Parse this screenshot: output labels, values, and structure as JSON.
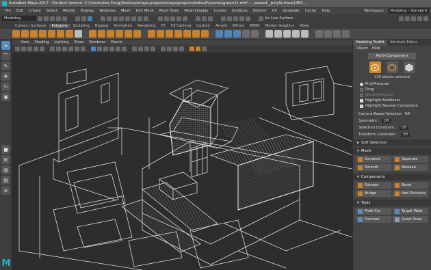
{
  "titlebar": {
    "title": "Autodesk Maya 2017 - Student Version: C:\\Users\\Alex Fung\\Desktop\\maya-projects\\maya\\projects\\default\\scenes\\green21.mb*  ---  pasted__polySurface1383..."
  },
  "menubar": {
    "items": [
      "File",
      "Edit",
      "Create",
      "Select",
      "Modify",
      "Display",
      "Windows",
      "Mesh",
      "Edit Mesh",
      "Mesh Tools",
      "Mesh Display",
      "Curves",
      "Surfaces",
      "Deform",
      "UV",
      "Generate",
      "Cache",
      "Help"
    ],
    "workspace_label": "Workspace :",
    "workspace_value": "Modeling - Standard"
  },
  "statusline": {
    "mode": "Modeling",
    "live_surface": "No Live Surface"
  },
  "shelf_tabs": {
    "items": [
      "Curves / Surfaces",
      "Polygons",
      "Sculpting",
      "Rigging",
      "Animation",
      "Rendering",
      "FX",
      "FX Caching",
      "Custom",
      "Arnold",
      "Bifrost",
      "MASH",
      "Motion Graphics",
      "XGen"
    ],
    "active": "Polygons"
  },
  "viewport": {
    "menu": [
      "View",
      "Shading",
      "Lighting",
      "Show",
      "Renderer",
      "Panels"
    ]
  },
  "panel": {
    "tabs": [
      "Modeling Toolkit",
      "Attribute Editor"
    ],
    "menu": [
      "Object",
      "Help"
    ],
    "multi_component": "Multi-Component",
    "selected_count": "128 objects selected",
    "radios": [
      {
        "label": "Pick/Marquee",
        "on": true
      },
      {
        "label": "Drag",
        "on": false
      },
      {
        "label": "Tweak/Marquee",
        "on": false,
        "dim": true
      },
      {
        "label": "Highlight Backfaces",
        "on": true
      },
      {
        "label": "Highlight Nearest Component",
        "on": true
      }
    ],
    "camera_based_label": "Camera-Based Selection",
    "camera_based_value": "Off",
    "symmetry_label": "Symmetry :",
    "symmetry_value": "Off",
    "selection_constraint_label": "Selection Constraint :",
    "selection_constraint_value": "Off",
    "transform_constraint_label": "Transform Constraint :",
    "transform_constraint_value": "Off",
    "soft_selection": "Soft Selection",
    "mesh_header": "Mesh",
    "mesh_buttons": [
      "Combine",
      "Separate",
      "Smooth",
      "Boolean"
    ],
    "components_header": "Components",
    "components_buttons": [
      "Extrude",
      "Bevel",
      "Bridge",
      "Add Divisions"
    ],
    "tools_header": "Tools",
    "tools_buttons": [
      "Multi-Cut",
      "Target Weld",
      "Connect",
      "Quad Draw"
    ]
  },
  "logo": "M"
}
